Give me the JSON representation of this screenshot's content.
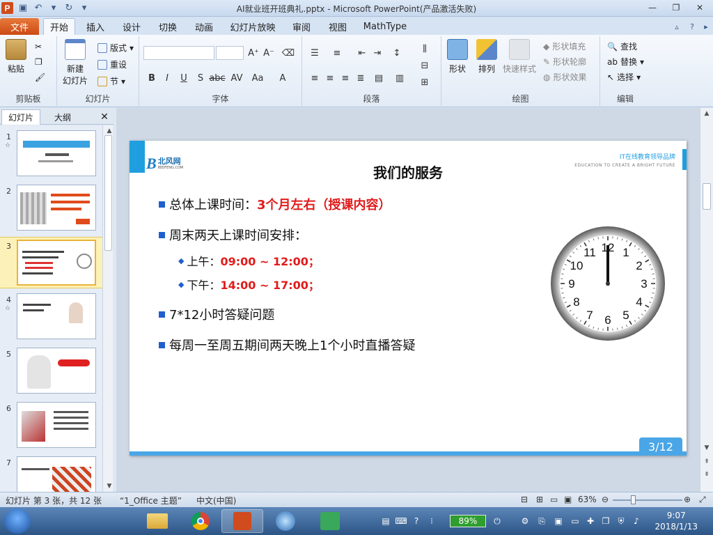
{
  "window": {
    "title": "AI就业班开班典礼.pptx - Microsoft PowerPoint(产品激活失败)",
    "app_logo": "P"
  },
  "ribbon_tabs": [
    "文件",
    "开始",
    "插入",
    "设计",
    "切换",
    "动画",
    "幻灯片放映",
    "审阅",
    "视图",
    "MathType"
  ],
  "ribbon": {
    "clipboard": {
      "paste": "粘贴",
      "label": "剪贴板"
    },
    "slides": {
      "new_slide_1": "新建",
      "new_slide_2": "幻灯片",
      "layout": "版式",
      "reset": "重设",
      "section": "节",
      "label": "幻灯片"
    },
    "font": {
      "label": "字体"
    },
    "paragraph": {
      "label": "段落"
    },
    "drawing": {
      "shape": "形状",
      "arrange": "排列",
      "quick_styles": "快速样式",
      "fill": "形状填充",
      "outline": "形状轮廓",
      "effects": "形状效果",
      "label": "绘图"
    },
    "editing": {
      "find": "查找",
      "replace": "替换",
      "select": "选择",
      "label": "编辑"
    }
  },
  "left_pane": {
    "tabs": [
      "幻灯片",
      "大纲"
    ],
    "close": "✕",
    "thumbnails": [
      {
        "num": "1",
        "star": true
      },
      {
        "num": "2",
        "star": false
      },
      {
        "num": "3",
        "star": false,
        "selected": true
      },
      {
        "num": "4",
        "star": true
      },
      {
        "num": "5",
        "star": false
      },
      {
        "num": "6",
        "star": false
      },
      {
        "num": "7",
        "star": false
      }
    ]
  },
  "slide": {
    "logo_mark": "B",
    "logo_text": "北风网",
    "logo_sub": "IBEIFENG.COM",
    "title": "我们的服务",
    "tagline": "IT在线教育领导品牌",
    "tagline_en": "EDUCATION TO CREATE A BRIGHT FUTURE",
    "bullet1_prefix": "总体上课时间：",
    "bullet1_value": "3个月左右（授课内容）",
    "bullet2": "周末两天上课时间安排：",
    "sub1_prefix": "上午：",
    "sub1_value": "09:00 ~ 12:00；",
    "sub2_prefix": "下午：",
    "sub2_value": "14:00 ~ 17:00；",
    "bullet3": "7*12小时答疑问题",
    "bullet4": "每周一至周五期间两天晚上1个小时直播答疑",
    "page": "3/12"
  },
  "status_bar": {
    "slide_info": "幻灯片 第 3 张，共 12 张",
    "theme": "“1_Office 主题”",
    "language": "中文(中国)",
    "zoom": "63%"
  },
  "taskbar": {
    "battery": "89%",
    "time": "9:07",
    "date": "2018/1/13"
  },
  "colors": {
    "accent_blue": "#1f9ee0",
    "bullet_blue": "#1f5fcf",
    "highlight_red": "#e11b1b",
    "file_tab": "#cc4a13"
  }
}
